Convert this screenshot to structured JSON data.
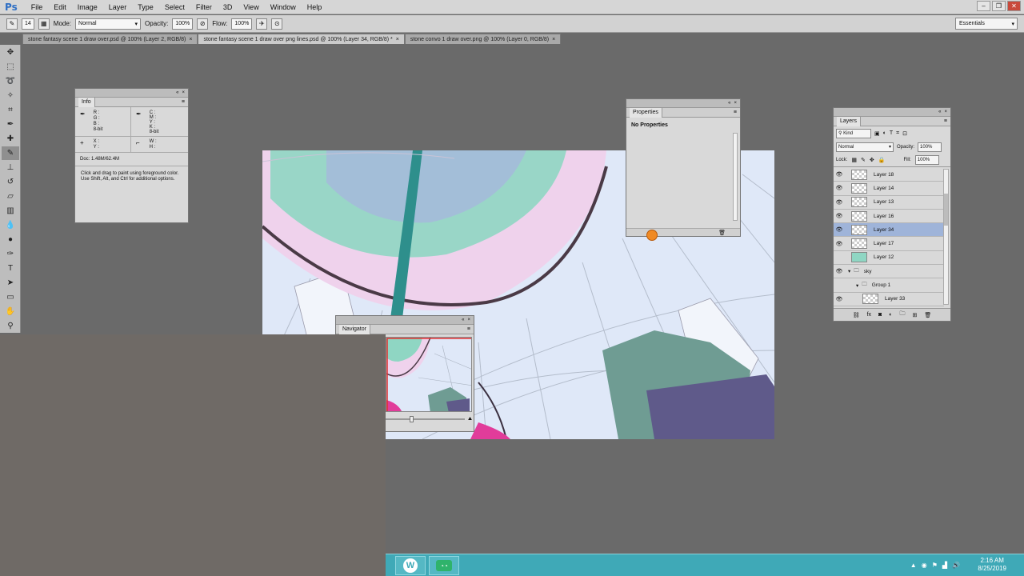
{
  "menubar": {
    "logo": "Ps",
    "items": [
      "File",
      "Edit",
      "Image",
      "Layer",
      "Type",
      "Select",
      "Filter",
      "3D",
      "View",
      "Window",
      "Help"
    ]
  },
  "options_bar": {
    "brush_size": "14",
    "mode_label": "Mode:",
    "mode_value": "Normal",
    "opacity_label": "Opacity:",
    "opacity_value": "100%",
    "flow_label": "Flow:",
    "flow_value": "100%",
    "workspace": "Essentials"
  },
  "tabs": [
    {
      "label": "stone fantasy scene 1 draw over.psd @ 100% (Layer 2, RGB/8)",
      "active": false
    },
    {
      "label": "stone fantasy scene 1 draw over png lines.psd @ 100% (Layer 34, RGB/8) *",
      "active": true
    },
    {
      "label": "stone convo 1 draw over.png @ 100% (Layer 0, RGB/8)",
      "active": false
    }
  ],
  "info_panel": {
    "title": "Info",
    "rgb": [
      "R :",
      "G :",
      "B :"
    ],
    "cmyk": [
      "C :",
      "M :",
      "Y :",
      "K :"
    ],
    "bit_left": "8-bit",
    "bit_right": "8-bit",
    "xy": [
      "X :",
      "Y :"
    ],
    "wh": [
      "W :",
      "H :"
    ],
    "doc": "Doc: 1.48M/62.4M",
    "hint": "Click and drag to paint using foreground color.  Use Shift, Alt, and Ctrl for additional options."
  },
  "properties_panel": {
    "title": "Properties",
    "content": "No Properties"
  },
  "navigator_panel": {
    "title": "Navigator"
  },
  "layers_panel": {
    "title": "Layers",
    "filter": "Kind",
    "blend_mode": "Normal",
    "opacity_label": "Opacity:",
    "opacity_value": "100%",
    "lock_label": "Lock:",
    "fill_label": "Fill:",
    "fill_value": "100%",
    "layers": [
      {
        "name": "Layer 18",
        "visible": true,
        "selected": false
      },
      {
        "name": "Layer 14",
        "visible": true,
        "selected": false
      },
      {
        "name": "Layer 13",
        "visible": true,
        "selected": false
      },
      {
        "name": "Layer 16",
        "visible": true,
        "selected": false
      },
      {
        "name": "Layer 34",
        "visible": true,
        "selected": true
      },
      {
        "name": "Layer 17",
        "visible": true,
        "selected": false
      },
      {
        "name": "Layer 12",
        "visible": false,
        "selected": false
      },
      {
        "name": "sky",
        "visible": true,
        "selected": false,
        "group": true
      },
      {
        "name": "Group 1",
        "visible": false,
        "selected": false,
        "group": true
      },
      {
        "name": "Layer 33",
        "visible": true,
        "selected": false
      }
    ]
  },
  "taskbar": {
    "time": "2:16 AM",
    "date": "8/25/2019"
  },
  "colors": {
    "canvas_sky": "#dde6f6",
    "dome_teal": "#87d4c0",
    "dome_pink": "#efd2ec",
    "taskbar": "#3fa9b7",
    "selected_layer": "#9fb4d9"
  }
}
